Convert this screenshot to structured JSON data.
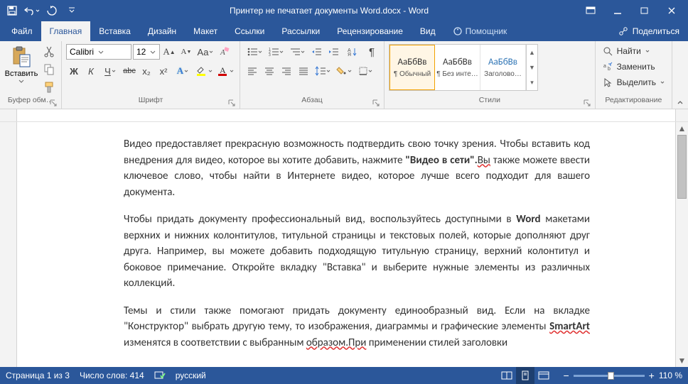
{
  "titlebar": {
    "doc_title": "Принтер не печатает документы Word.docx  -  Word"
  },
  "tabs": {
    "file": "Файл",
    "home": "Главная",
    "insert": "Вставка",
    "design": "Дизайн",
    "layout": "Макет",
    "references": "Ссылки",
    "mailings": "Рассылки",
    "review": "Рецензирование",
    "view": "Вид",
    "tell_me": "Помощник",
    "share": "Поделиться"
  },
  "ribbon": {
    "clipboard": {
      "paste": "Вставить",
      "group": "Буфер обм…"
    },
    "font": {
      "name": "Calibri",
      "size": "12",
      "group": "Шрифт",
      "bold": "Ж",
      "italic": "К",
      "underline": "Ч",
      "strike": "abc",
      "sub": "x₂",
      "sup": "x²"
    },
    "para": {
      "group": "Абзац"
    },
    "styles": {
      "group": "Стили",
      "items": [
        {
          "preview": "АаБбВв",
          "name": "¶ Обычный"
        },
        {
          "preview": "АаБбВв",
          "name": "¶ Без инте…"
        },
        {
          "preview": "АаБбВ⁠в",
          "name": "Заголово…"
        }
      ]
    },
    "editing": {
      "group": "Редактирование",
      "find": "Найти",
      "replace": "Заменить",
      "select": "Выделить"
    }
  },
  "document": {
    "p1a": "Видео предоставляет прекрасную возможность подтвердить свою точку зрения. Чтобы вставить код внедрения для видео, которое вы хотите добавить, нажмите ",
    "p1b": "\"Видео в сети\".",
    "p1c": "Вы",
    "p1d": " также можете ввести ключевое слово, чтобы найти в Интернете видео, которое лучше всего подходит для вашего документа.",
    "p2a": "Чтобы придать документу профессиональный вид, воспользуйтесь доступными в ",
    "p2b": "Word",
    "p2c": " макетами верхних и нижних колонтитулов, титульной страницы и текстовых полей, которые дополняют друг друга. Например, вы можете добавить подходящую титульную страницу, верхний колонтитул и боковое примечание. Откройте вкладку \"Вставка\" и выберите нужные элементы из различных коллекций.",
    "p3a": "Темы и стили также помогают придать документу единообразный вид. Если на вкладке \"Конструктор\" выбрать другую тему, то изображения, диаграммы и графические элементы ",
    "p3b": "SmartArt",
    "p3c": " изменятся в соответствии с выбранным ",
    "p3d": "образом.При",
    "p3e": " применении стилей заголовки"
  },
  "status": {
    "page": "Страница 1 из 3",
    "words": "Число слов: 414",
    "lang": "русский",
    "zoom": "110 %"
  }
}
